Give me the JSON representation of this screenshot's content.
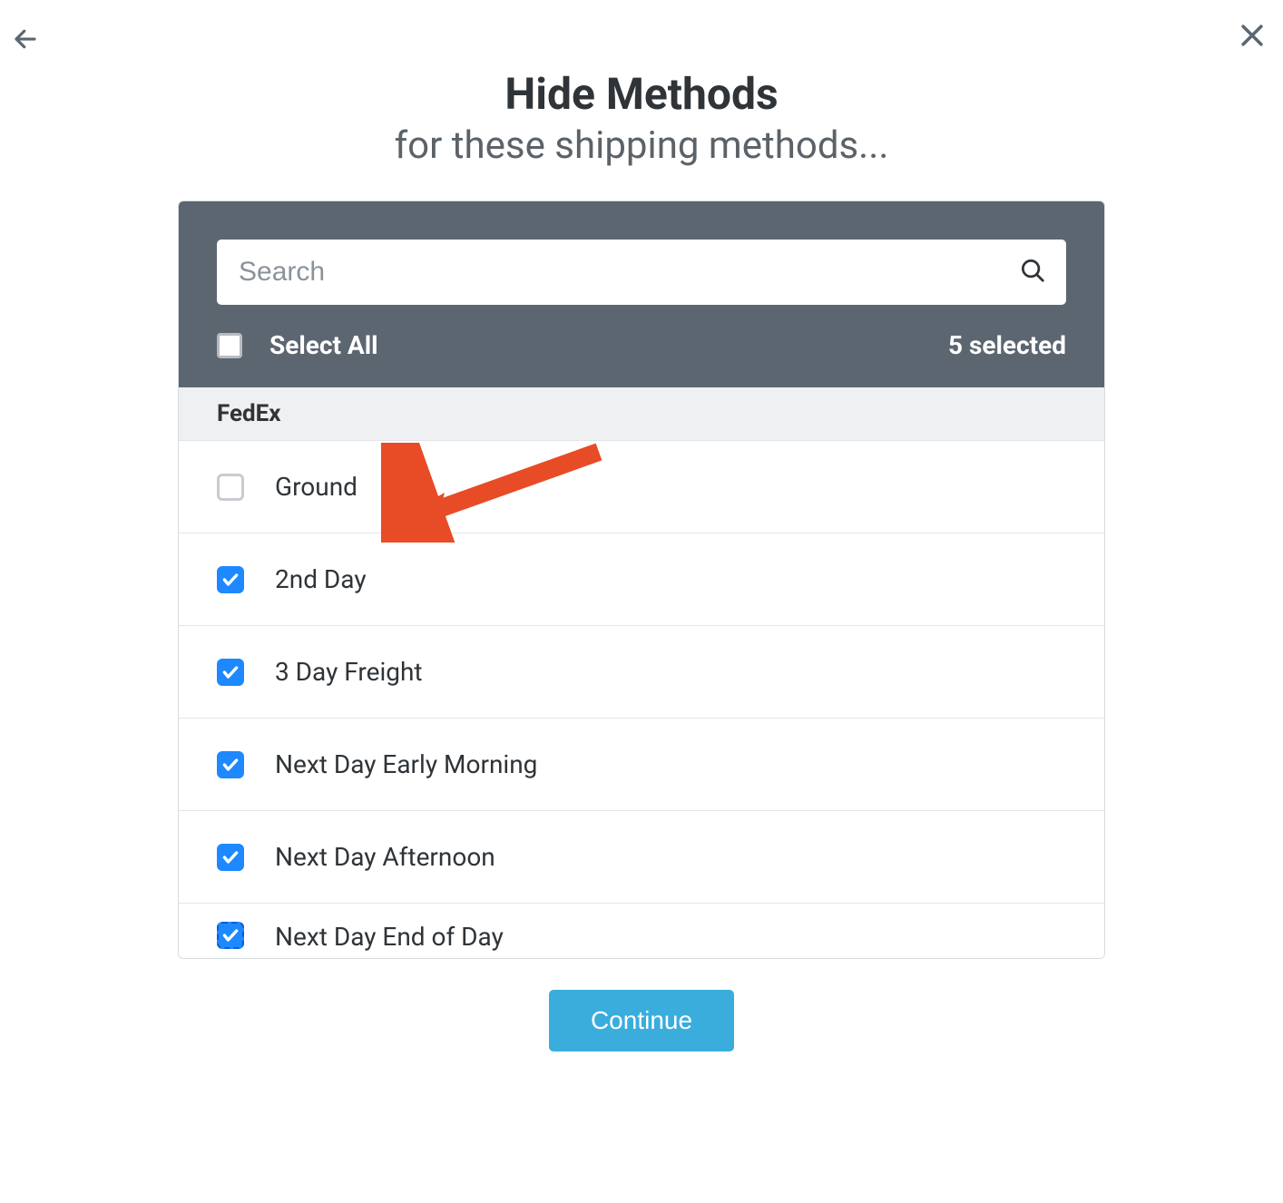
{
  "header": {
    "title": "Hide Methods",
    "subtitle": "for these shipping methods..."
  },
  "search": {
    "placeholder": "Search",
    "value": ""
  },
  "selectAll": {
    "label": "Select All",
    "checked": false
  },
  "selectedCount": "5 selected",
  "group": {
    "name": "FedEx",
    "methods": [
      {
        "label": "Ground",
        "checked": false
      },
      {
        "label": "2nd Day",
        "checked": true
      },
      {
        "label": "3 Day Freight",
        "checked": true
      },
      {
        "label": "Next Day Early Morning",
        "checked": true
      },
      {
        "label": "Next Day Afternoon",
        "checked": true
      },
      {
        "label": "Next Day End of Day",
        "checked": true
      }
    ]
  },
  "footer": {
    "continue": "Continue"
  }
}
